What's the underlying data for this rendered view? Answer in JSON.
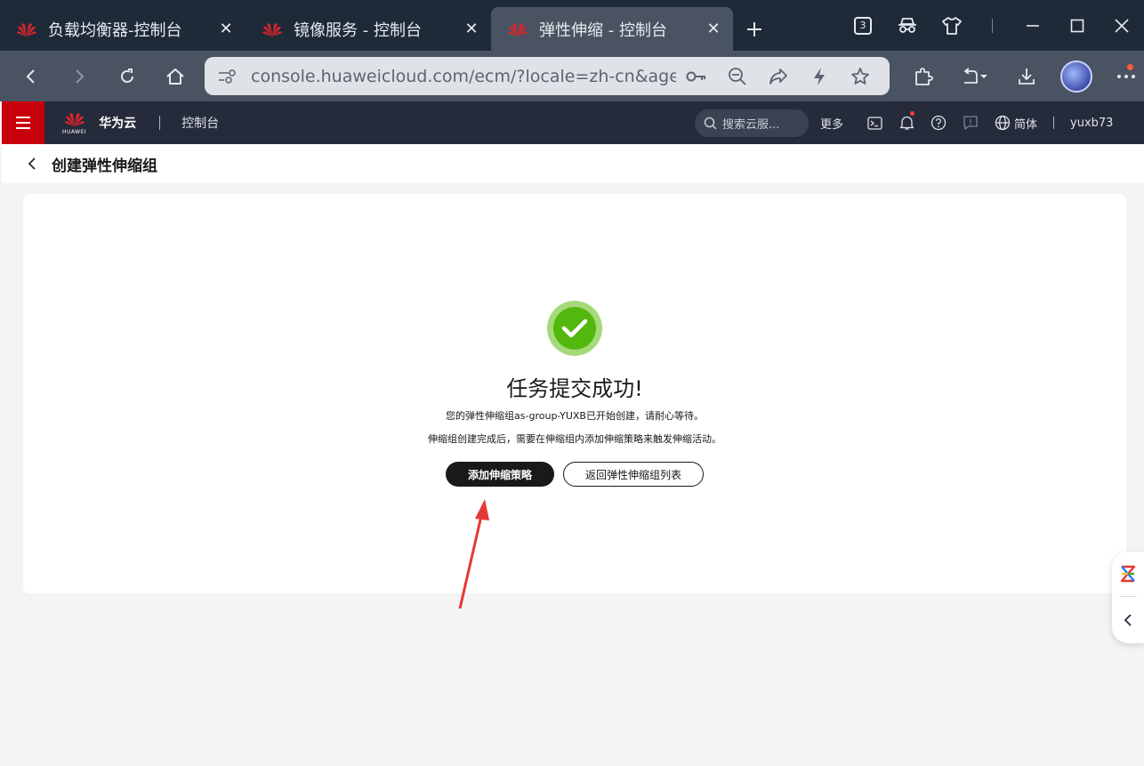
{
  "browser": {
    "tabs": [
      {
        "title": "负载均衡器-控制台",
        "active": false
      },
      {
        "title": "镜像服务 - 控制台",
        "active": false
      },
      {
        "title": "弹性伸缩 - 控制台",
        "active": true
      }
    ],
    "tab_count": "3",
    "address": "console.huaweicloud.com/ecm/?locale=zh-cn&agen..."
  },
  "console_header": {
    "logo_word": "HUAWEI",
    "brand": "华为云",
    "console_link": "控制台",
    "search_placeholder": "搜索云服...",
    "more": "更多",
    "language": "简体",
    "user": "yuxb73"
  },
  "page": {
    "title": "创建弹性伸缩组"
  },
  "result": {
    "title": "任务提交成功!",
    "desc_line1": "您的弹性伸缩组as-group-YUXB已开始创建，请耐心等待。",
    "desc_line2": "伸缩组创建完成后，需要在伸缩组内添加伸缩策略来触发伸缩活动。",
    "primary_button": "添加伸缩策略",
    "secondary_button": "返回弹性伸缩组列表"
  },
  "colors": {
    "brand_red": "#c7000b",
    "success_green": "#52b80e",
    "header_bg": "#252b3a",
    "annotation_red": "#e53935"
  }
}
